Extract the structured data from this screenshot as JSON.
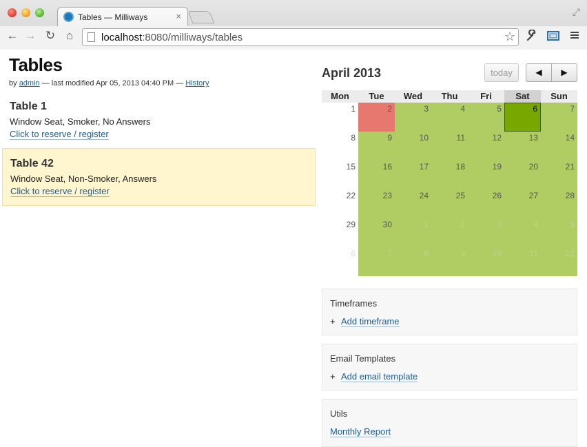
{
  "browser": {
    "tab_title": "Tables — Milliways",
    "tab_close": "×",
    "url_host": "localhost",
    "url_port": ":8080",
    "url_path": "/milliways/tables",
    "icons": {
      "back": "back-arrow-icon",
      "forward": "forward-arrow-icon",
      "reload": "reload-icon",
      "home": "home-icon",
      "star": "star-icon",
      "wrench": "wrench-icon",
      "screen": "screen-icon",
      "menu": "menu-icon"
    }
  },
  "page": {
    "title": "Tables",
    "byline": {
      "prefix": "by",
      "author": "admin",
      "modified": "— last modified Apr 05, 2013 04:40 PM —",
      "history": "History"
    },
    "tables": [
      {
        "name": "Table 1",
        "description": "Window Seat, Smoker, No Answers",
        "link": "Click to reserve / register",
        "highlighted": false
      },
      {
        "name": "Table 42",
        "description": "Window Seat, Non-Smoker, Answers",
        "link": "Click to reserve / register",
        "highlighted": true
      }
    ]
  },
  "calendar": {
    "title": "April 2013",
    "today_button": "today",
    "prev_button": "◀",
    "next_button": "▶",
    "weekdays": [
      "Mon",
      "Tue",
      "Wed",
      "Thu",
      "Fri",
      "Sat",
      "Sun"
    ],
    "highlight_weekday": "Sat",
    "colors": {
      "available": "#b0cd64",
      "booked": "#e77870",
      "today": "#78a800"
    },
    "weeks": [
      [
        {
          "d": "1",
          "s": "blank"
        },
        {
          "d": "2",
          "s": "booked"
        },
        {
          "d": "3",
          "s": "available"
        },
        {
          "d": "4",
          "s": "available"
        },
        {
          "d": "5",
          "s": "available"
        },
        {
          "d": "6",
          "s": "today"
        },
        {
          "d": "7",
          "s": "available"
        }
      ],
      [
        {
          "d": "8",
          "s": "blank"
        },
        {
          "d": "9",
          "s": "available"
        },
        {
          "d": "10",
          "s": "available"
        },
        {
          "d": "11",
          "s": "available"
        },
        {
          "d": "12",
          "s": "available"
        },
        {
          "d": "13",
          "s": "available"
        },
        {
          "d": "14",
          "s": "available"
        }
      ],
      [
        {
          "d": "15",
          "s": "blank"
        },
        {
          "d": "16",
          "s": "available"
        },
        {
          "d": "17",
          "s": "available"
        },
        {
          "d": "18",
          "s": "available"
        },
        {
          "d": "19",
          "s": "available"
        },
        {
          "d": "20",
          "s": "available"
        },
        {
          "d": "21",
          "s": "available"
        }
      ],
      [
        {
          "d": "22",
          "s": "blank"
        },
        {
          "d": "23",
          "s": "available"
        },
        {
          "d": "24",
          "s": "available"
        },
        {
          "d": "25",
          "s": "available"
        },
        {
          "d": "26",
          "s": "available"
        },
        {
          "d": "27",
          "s": "available"
        },
        {
          "d": "28",
          "s": "available"
        }
      ],
      [
        {
          "d": "29",
          "s": "blank"
        },
        {
          "d": "30",
          "s": "available"
        },
        {
          "d": "1",
          "s": "other"
        },
        {
          "d": "2",
          "s": "other"
        },
        {
          "d": "3",
          "s": "other"
        },
        {
          "d": "4",
          "s": "other"
        },
        {
          "d": "5",
          "s": "other"
        }
      ],
      [
        {
          "d": "6",
          "s": "other-blank"
        },
        {
          "d": "7",
          "s": "other"
        },
        {
          "d": "8",
          "s": "other"
        },
        {
          "d": "9",
          "s": "other"
        },
        {
          "d": "10",
          "s": "other"
        },
        {
          "d": "11",
          "s": "other"
        },
        {
          "d": "12",
          "s": "other"
        }
      ]
    ]
  },
  "panels": {
    "timeframes": {
      "title": "Timeframes",
      "plus": "+",
      "link": "Add timeframe"
    },
    "email_templates": {
      "title": "Email Templates",
      "plus": "+",
      "link": "Add email template"
    },
    "utils": {
      "title": "Utils",
      "link": "Monthly Report"
    }
  }
}
